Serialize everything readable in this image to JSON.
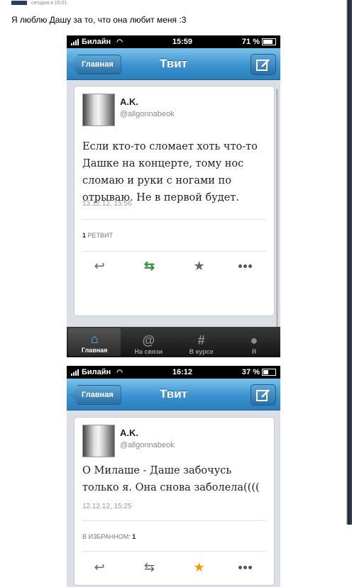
{
  "post": {
    "time": "сегодня в 16:01",
    "text": "Я люблю Дашу за то, что она любит меня :3"
  },
  "screens": [
    {
      "status": {
        "carrier": "Билайн",
        "time": "15:59",
        "battery": "71 %",
        "battery_level": 0.71
      },
      "nav": {
        "back": "Главная",
        "title": "Твит"
      },
      "tweet": {
        "name": "A.K.",
        "handle": "@allgonnabeok",
        "text": "Если кто-то сломает хоть что-то Дашке на концерте, тому нос сломаю и руки с ногами по отрываю. Не в первой будет.",
        "date": "13.12.12, 15:56",
        "stat_count": "1",
        "stat_label": "РЕТВИТ"
      },
      "tabs": [
        {
          "label": "Главная",
          "icon": "home-icon"
        },
        {
          "label": "На связи",
          "icon": "at-icon"
        },
        {
          "label": "В курсе",
          "icon": "hash-icon"
        },
        {
          "label": "Я",
          "icon": "person-icon"
        }
      ]
    },
    {
      "status": {
        "carrier": "Билайн",
        "time": "16:12",
        "battery": "37 %",
        "battery_level": 0.37
      },
      "nav": {
        "back": "Главная",
        "title": "Твит"
      },
      "tweet": {
        "name": "A.K.",
        "handle": "@allgonnabeok",
        "text": "О Милаше - Даше забочусь только я. Она снова заболела((((",
        "date": "12.12.12, 15:25",
        "stat_label": "В ИЗБРАННОМ:",
        "stat_count": "1"
      }
    }
  ],
  "colors": {
    "accent": "#3b92cf",
    "retweet": "#3a8f3a",
    "favorite": "#f29b0c"
  }
}
